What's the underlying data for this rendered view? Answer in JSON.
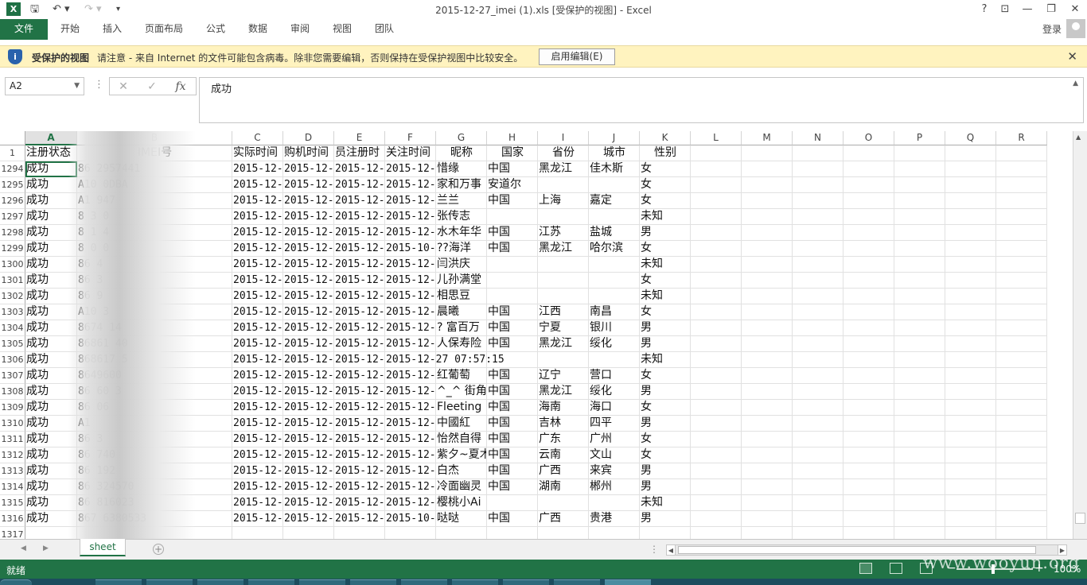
{
  "titlebar": {
    "app_icon": "X",
    "title": "2015-12-27_imei (1).xls  [受保护的视图] - Excel",
    "help": "?",
    "restore_ribbon": "⊡",
    "minimize": "—",
    "maximize": "❐",
    "close": "✕"
  },
  "ribbon": {
    "tabs": [
      "文件",
      "开始",
      "插入",
      "页面布局",
      "公式",
      "数据",
      "审阅",
      "视图",
      "团队"
    ],
    "login": "登录"
  },
  "protected_view": {
    "title": "受保护的视图",
    "message": "请注意 - 来自 Internet 的文件可能包含病毒。除非您需要编辑，否则保持在受保护视图中比较安全。",
    "enable_button": "启用编辑(E)",
    "close": "✕"
  },
  "formula_bar": {
    "name_box": "A2",
    "cancel": "✕",
    "confirm": "✓",
    "fx": "fx",
    "value": "成功"
  },
  "grid": {
    "columns": [
      "A",
      "B",
      "C",
      "D",
      "E",
      "F",
      "G",
      "H",
      "I",
      "J",
      "K",
      "L",
      "M",
      "N",
      "O",
      "P",
      "Q",
      "R"
    ],
    "selected_column": "A",
    "header_row": {
      "row_num": "1",
      "cells": [
        "注册状态",
        "IMEI号",
        "实际时间",
        "购机时间",
        "员注册时",
        "关注时间",
        "昵称",
        "国家",
        "省份",
        "城市",
        "性别"
      ]
    },
    "rows": [
      {
        "n": "1294",
        "a": "成功",
        "b": "86    2957441",
        "c": "2015-12-",
        "d": "2015-12-",
        "e": "2015-12-",
        "f": "2015-12-",
        "g": "惜缘",
        "h": "中国",
        "i": "黑龙江",
        "j": "佳木斯",
        "k": "女"
      },
      {
        "n": "1295",
        "a": "成功",
        "b": "A10    0DBA",
        "c": "2015-12-",
        "d": "2015-12-",
        "e": "2015-12-",
        "f": "2015-12-",
        "g": "家和万事",
        "h": "安道尔",
        "i": "",
        "j": "",
        "k": "女"
      },
      {
        "n": "1296",
        "a": "成功",
        "b": "A1     947",
        "c": "2015-12-",
        "d": "2015-12-",
        "e": "2015-12-",
        "f": "2015-12-",
        "g": "兰兰",
        "h": "中国",
        "i": "上海",
        "j": "嘉定",
        "k": "女"
      },
      {
        "n": "1297",
        "a": "成功",
        "b": "8    3    0",
        "c": "2015-12-",
        "d": "2015-12-",
        "e": "2015-12-",
        "f": "2015-12-",
        "g": "张传志",
        "h": "",
        "i": "",
        "j": "",
        "k": "未知"
      },
      {
        "n": "1298",
        "a": "成功",
        "b": "8    1    4",
        "c": "2015-12-",
        "d": "2015-12-",
        "e": "2015-12-",
        "f": "2015-12-",
        "g": "水木年华",
        "h": "中国",
        "i": "江苏",
        "j": "盐城",
        "k": "男"
      },
      {
        "n": "1299",
        "a": "成功",
        "b": "8    0    0",
        "c": "2015-12-",
        "d": "2015-12-",
        "e": "2015-12-",
        "f": "2015-10-",
        "g": "??海洋",
        "h": "中国",
        "i": "黑龙江",
        "j": "哈尔滨",
        "k": "女"
      },
      {
        "n": "1300",
        "a": "成功",
        "b": "86    4",
        "c": "2015-12-",
        "d": "2015-12-",
        "e": "2015-12-",
        "f": "2015-12-",
        "g": "闫洪庆",
        "h": "",
        "i": "",
        "j": "",
        "k": "未知"
      },
      {
        "n": "1301",
        "a": "成功",
        "b": "86     3",
        "c": "2015-12-",
        "d": "2015-12-",
        "e": "2015-12-",
        "f": "2015-12-",
        "g": "儿孙满堂",
        "h": "",
        "i": "",
        "j": "",
        "k": "女"
      },
      {
        "n": "1302",
        "a": "成功",
        "b": "86     9",
        "c": "2015-12-",
        "d": "2015-12-",
        "e": "2015-12-",
        "f": "2015-12-",
        "g": "相思豆",
        "h": "",
        "i": "",
        "j": "",
        "k": "未知"
      },
      {
        "n": "1303",
        "a": "成功",
        "b": "A10    3",
        "c": "2015-12-",
        "d": "2015-12-",
        "e": "2015-12-",
        "f": "2015-12-",
        "g": "晨曦",
        "h": "中国",
        "i": "江西",
        "j": "南昌",
        "k": "女"
      },
      {
        "n": "1304",
        "a": "成功",
        "b": "8674    14",
        "c": "2015-12-",
        "d": "2015-12-",
        "e": "2015-12-",
        "f": "2015-12-",
        "g": "? 富百万",
        "h": "中国",
        "i": "宁夏",
        "j": "银川",
        "k": "男"
      },
      {
        "n": "1305",
        "a": "成功",
        "b": "86861    40",
        "c": "2015-12-",
        "d": "2015-12-",
        "e": "2015-12-",
        "f": "2015-12-",
        "g": "人保寿险",
        "h": "中国",
        "i": "黑龙江",
        "j": "绥化",
        "k": "男"
      },
      {
        "n": "1306",
        "a": "成功",
        "b": "868617    5",
        "c": "2015-12-",
        "d": "2015-12-",
        "e": "2015-12-",
        "f": "2015-12-27 07:57:15",
        "g": "",
        "h": "",
        "i": "",
        "j": "",
        "k": "未知"
      },
      {
        "n": "1307",
        "a": "成功",
        "b": "8649600",
        "c": "2015-12-",
        "d": "2015-12-",
        "e": "2015-12-",
        "f": "2015-12-",
        "g": "红葡萄",
        "h": "中国",
        "i": "辽宁",
        "j": "营口",
        "k": "女"
      },
      {
        "n": "1308",
        "a": "成功",
        "b": "86    60    3",
        "c": "2015-12-",
        "d": "2015-12-",
        "e": "2015-12-",
        "f": "2015-12-",
        "g": "^_^ 街角",
        "h": "中国",
        "i": "黑龙江",
        "j": "绥化",
        "k": "男"
      },
      {
        "n": "1309",
        "a": "成功",
        "b": "86    06",
        "c": "2015-12-",
        "d": "2015-12-",
        "e": "2015-12-",
        "f": "2015-12-",
        "g": "Fleeting",
        "h": "中国",
        "i": "海南",
        "j": "海口",
        "k": "女"
      },
      {
        "n": "1310",
        "a": "成功",
        "b": "A1",
        "c": "2015-12-",
        "d": "2015-12-",
        "e": "2015-12-",
        "f": "2015-12-",
        "g": "中國紅",
        "h": "中国",
        "i": "吉林",
        "j": "四平",
        "k": "男"
      },
      {
        "n": "1311",
        "a": "成功",
        "b": "86     3",
        "c": "2015-12-",
        "d": "2015-12-",
        "e": "2015-12-",
        "f": "2015-12-",
        "g": "怡然自得",
        "h": "中国",
        "i": "广东",
        "j": "广州",
        "k": "女"
      },
      {
        "n": "1312",
        "a": "成功",
        "b": "86    740",
        "c": "2015-12-",
        "d": "2015-12-",
        "e": "2015-12-",
        "f": "2015-12-",
        "g": "紫夕~夏木",
        "h": "中国",
        "i": "云南",
        "j": "文山",
        "k": "女"
      },
      {
        "n": "1313",
        "a": "成功",
        "b": "86    192",
        "c": "2015-12-",
        "d": "2015-12-",
        "e": "2015-12-",
        "f": "2015-12-",
        "g": "白杰",
        "h": "中国",
        "i": "广西",
        "j": "来宾",
        "k": "男"
      },
      {
        "n": "1314",
        "a": "成功",
        "b": "86    324570",
        "c": "2015-12-",
        "d": "2015-12-",
        "e": "2015-12-",
        "f": "2015-12-",
        "g": "冷面幽灵",
        "h": "中国",
        "i": "湖南",
        "j": "郴州",
        "k": "男"
      },
      {
        "n": "1315",
        "a": "成功",
        "b": "86    816023",
        "c": "2015-12-",
        "d": "2015-12-",
        "e": "2015-12-",
        "f": "2015-12-",
        "g": "樱桃小Ai",
        "h": "",
        "i": "",
        "j": "",
        "k": "未知"
      },
      {
        "n": "1316",
        "a": "成功",
        "b": "867    6380533",
        "c": "2015-12-",
        "d": "2015-12-",
        "e": "2015-12-",
        "f": "2015-10-",
        "g": "哒哒",
        "h": "中国",
        "i": "广西",
        "j": "贵港",
        "k": "男"
      },
      {
        "n": "1317",
        "a": "",
        "b": "",
        "c": "",
        "d": "",
        "e": "",
        "f": "",
        "g": "",
        "h": "",
        "i": "",
        "j": "",
        "k": ""
      }
    ]
  },
  "sheet_tabs": {
    "tabs": [
      "sheet"
    ],
    "active": "sheet",
    "add": "+"
  },
  "statusbar": {
    "status": "就绪",
    "zoom_minus": "−",
    "zoom_plus": "+",
    "zoom": "100%"
  },
  "watermark": "www.wooyun.org",
  "colors": {
    "excel_green": "#217346",
    "protected_bar": "#fff3bf",
    "shield_blue": "#2a62ac"
  }
}
